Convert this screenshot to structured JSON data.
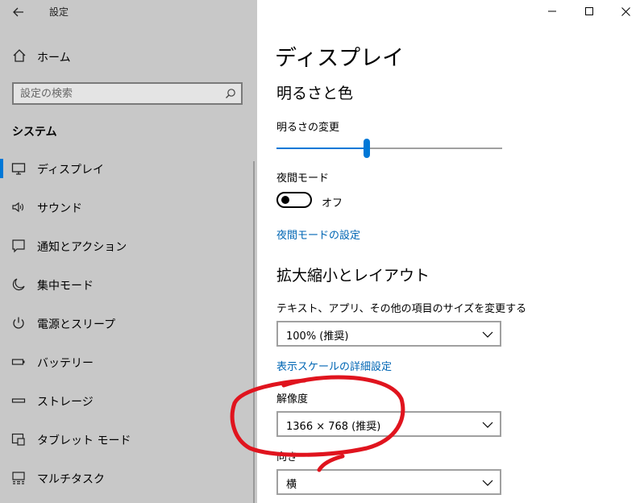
{
  "window": {
    "title": "設定"
  },
  "sidebar": {
    "home_label": "ホーム",
    "search": {
      "placeholder": "設定の検索",
      "value": ""
    },
    "section": "システム",
    "items": [
      {
        "label": "ディスプレイ",
        "icon": "monitor-icon",
        "active": true
      },
      {
        "label": "サウンド",
        "icon": "speaker-icon"
      },
      {
        "label": "通知とアクション",
        "icon": "notification-icon"
      },
      {
        "label": "集中モード",
        "icon": "moon-icon"
      },
      {
        "label": "電源とスリープ",
        "icon": "power-icon"
      },
      {
        "label": "バッテリー",
        "icon": "battery-icon"
      },
      {
        "label": "ストレージ",
        "icon": "storage-icon"
      },
      {
        "label": "タブレット モード",
        "icon": "tablet-icon"
      },
      {
        "label": "マルチタスク",
        "icon": "multitask-icon"
      }
    ]
  },
  "main": {
    "title": "ディスプレイ",
    "brightness_section": "明るさと色",
    "brightness_label": "明るさの変更",
    "brightness_value": 0.4,
    "night_mode_label": "夜間モード",
    "night_mode_state": "オフ",
    "night_mode_link": "夜間モードの設定",
    "scale_section": "拡大縮小とレイアウト",
    "scale_label": "テキスト、アプリ、その他の項目のサイズを変更する",
    "scale_value": "100% (推奨)",
    "advanced_scale_link": "表示スケールの詳細設定",
    "resolution_label": "解像度",
    "resolution_value": "1366 × 768 (推奨)",
    "orientation_label": "向き",
    "orientation_value": "横"
  },
  "colors": {
    "accent": "#0078d7",
    "link": "#0066b4",
    "sidebar_bg": "#c8c8c8",
    "annotation": "#e0141e"
  }
}
